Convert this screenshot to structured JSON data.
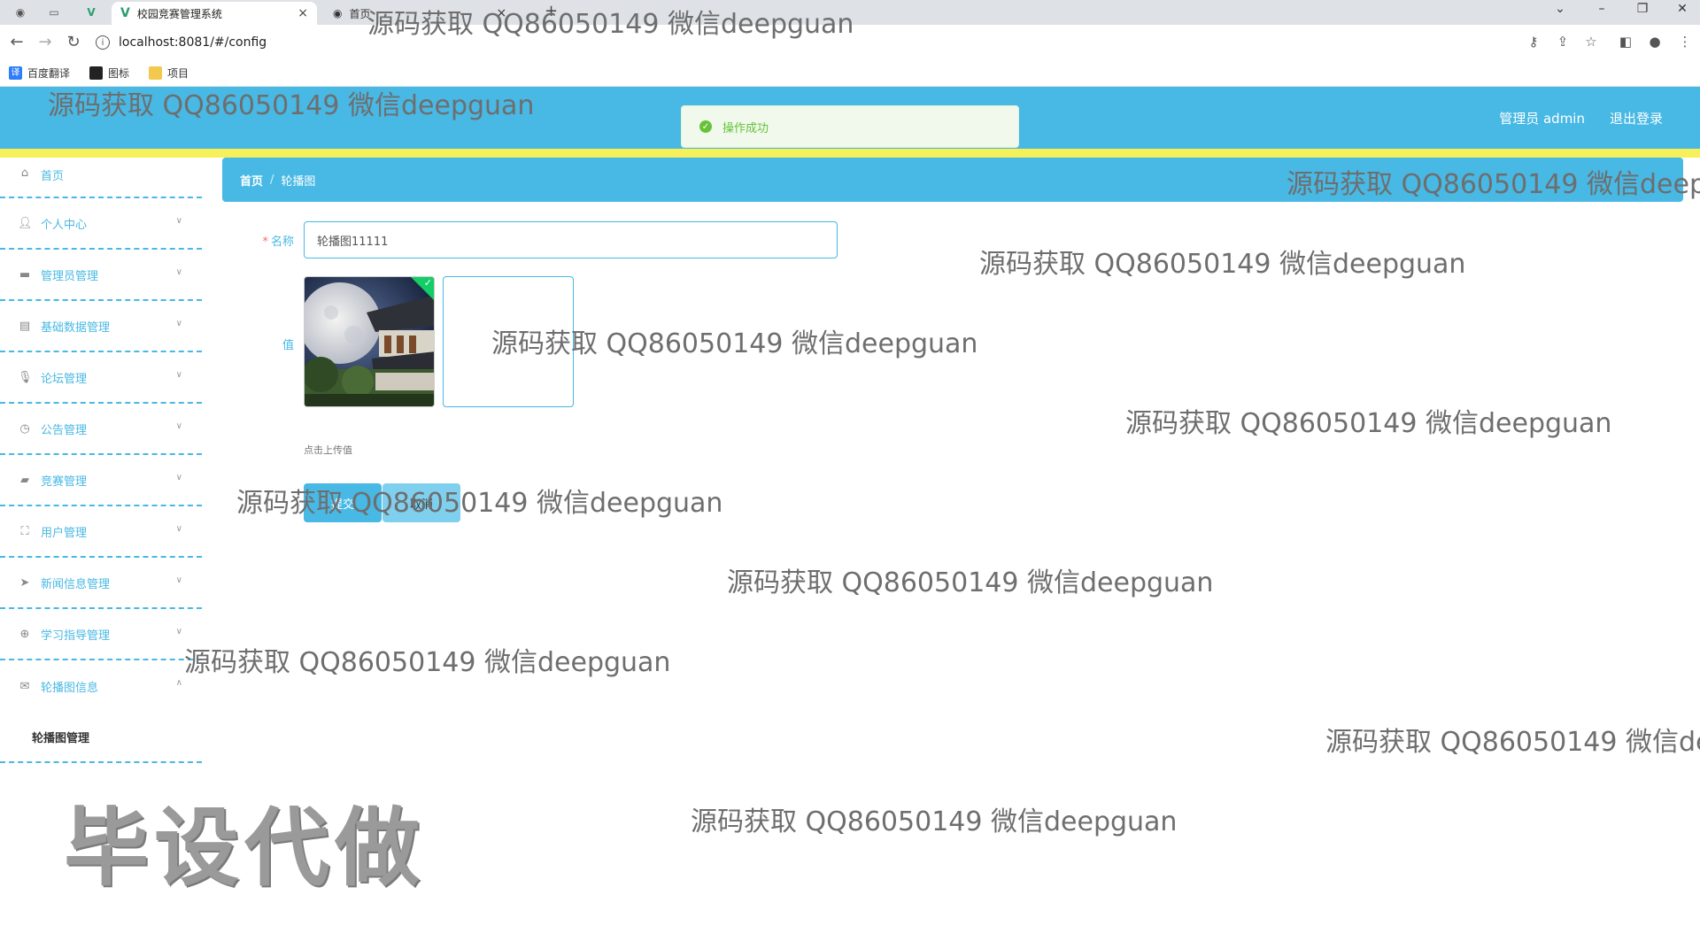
{
  "browser": {
    "tabs": [
      {
        "title": "校园竞赛管理系统",
        "active": true
      },
      {
        "title": "首页",
        "active": false
      }
    ],
    "url": "localhost:8081/#/config",
    "bookmarks": [
      "百度翻译",
      "图标",
      "项目"
    ]
  },
  "header": {
    "user_label": "管理员 admin",
    "logout_label": "退出登录"
  },
  "toast": {
    "message": "操作成功"
  },
  "sidebar": {
    "items": [
      {
        "label": "首页",
        "icon": "home-icon"
      },
      {
        "label": "个人中心",
        "icon": "user-icon"
      },
      {
        "label": "管理员管理",
        "icon": "admin-icon"
      },
      {
        "label": "基础数据管理",
        "icon": "data-icon"
      },
      {
        "label": "论坛管理",
        "icon": "mic-icon"
      },
      {
        "label": "公告管理",
        "icon": "notice-icon"
      },
      {
        "label": "竞赛管理",
        "icon": "trophy-icon"
      },
      {
        "label": "用户管理",
        "icon": "users-icon"
      },
      {
        "label": "新闻信息管理",
        "icon": "send-icon"
      },
      {
        "label": "学习指导管理",
        "icon": "guide-icon"
      },
      {
        "label": "轮播图信息",
        "icon": "mail-icon"
      }
    ],
    "sub_item": "轮播图管理"
  },
  "breadcrumb": {
    "home": "首页",
    "separator": "/",
    "current": "轮播图"
  },
  "form": {
    "name_label": "名称",
    "required_mark": "*",
    "name_value": "轮播图11111",
    "value_label": "值",
    "upload_tip": "点击上传值",
    "submit_label": "提交",
    "cancel_label": "取消"
  },
  "watermarks": {
    "text": "源码获取 QQ86050149 微信deepguan",
    "big_text": "毕设代做"
  }
}
